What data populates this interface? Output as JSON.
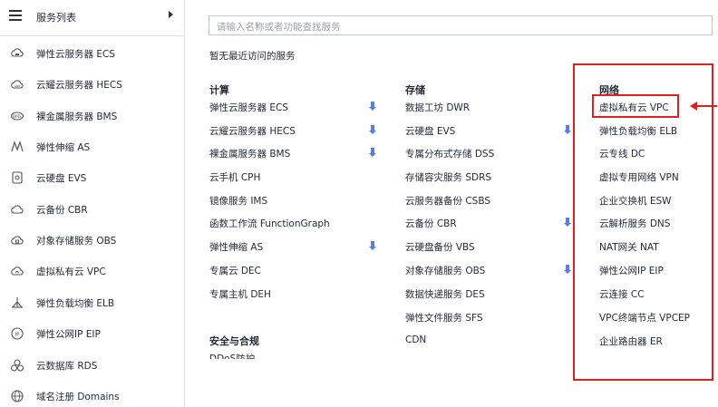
{
  "sidebar": {
    "title": "服务列表",
    "items": [
      {
        "label": "弹性云服务器 ECS",
        "icon": "cloud-server-icon"
      },
      {
        "label": "云耀云服务器 HECS",
        "icon": "cloud-icon"
      },
      {
        "label": "裸金属服务器 BMS",
        "icon": "bare-metal-icon"
      },
      {
        "label": "弹性伸缩 AS",
        "icon": "auto-scaling-icon"
      },
      {
        "label": "云硬盘 EVS",
        "icon": "disk-icon"
      },
      {
        "label": "云备份 CBR",
        "icon": "cloud-backup-icon"
      },
      {
        "label": "对象存储服务 OBS",
        "icon": "object-storage-icon"
      },
      {
        "label": "虚拟私有云 VPC",
        "icon": "vpc-icon"
      },
      {
        "label": "弹性负载均衡 ELB",
        "icon": "load-balancer-icon"
      },
      {
        "label": "弹性公网IP EIP",
        "icon": "eip-icon"
      },
      {
        "label": "云数据库 RDS",
        "icon": "database-icon"
      },
      {
        "label": "域名注册 Domains",
        "icon": "globe-icon"
      }
    ]
  },
  "search": {
    "placeholder": "请输入名称或者功能查找服务"
  },
  "recent": "暂无最近访问的服务",
  "columns": {
    "compute": {
      "title": "计算",
      "items": [
        "弹性云服务器 ECS",
        "云耀云服务器 HECS",
        "裸金属服务器 BMS",
        "云手机 CPH",
        "镜像服务 IMS",
        "函数工作流 FunctionGraph",
        "弹性伸缩 AS",
        "专属云 DEC",
        "专属主机 DEH"
      ]
    },
    "security": {
      "title": "安全与合规",
      "items": [
        "DDoS防护"
      ]
    },
    "storage": {
      "title": "存储",
      "items": [
        "数据工坊 DWR",
        "云硬盘 EVS",
        "专属分布式存储 DSS",
        "存储容灾服务 SDRS",
        "云服务器备份 CSBS",
        "云备份 CBR",
        "云硬盘备份 VBS",
        "对象存储服务 OBS",
        "数据快递服务 DES",
        "弹性文件服务 SFS",
        "CDN"
      ]
    },
    "network": {
      "title": "网络",
      "items": [
        "虚拟私有云 VPC",
        "弹性负载均衡 ELB",
        "云专线 DC",
        "虚拟专用网络 VPN",
        "企业交换机 ESW",
        "云解析服务 DNS",
        "NAT网关 NAT",
        "弹性公网IP EIP",
        "云连接 CC",
        "VPC终端节点 VPCEP",
        "企业路由器 ER"
      ]
    }
  },
  "colors": {
    "highlight": "#e02020",
    "pin": "#5b7ce0",
    "text": "#252b3a",
    "border": "#dfe1e6"
  }
}
